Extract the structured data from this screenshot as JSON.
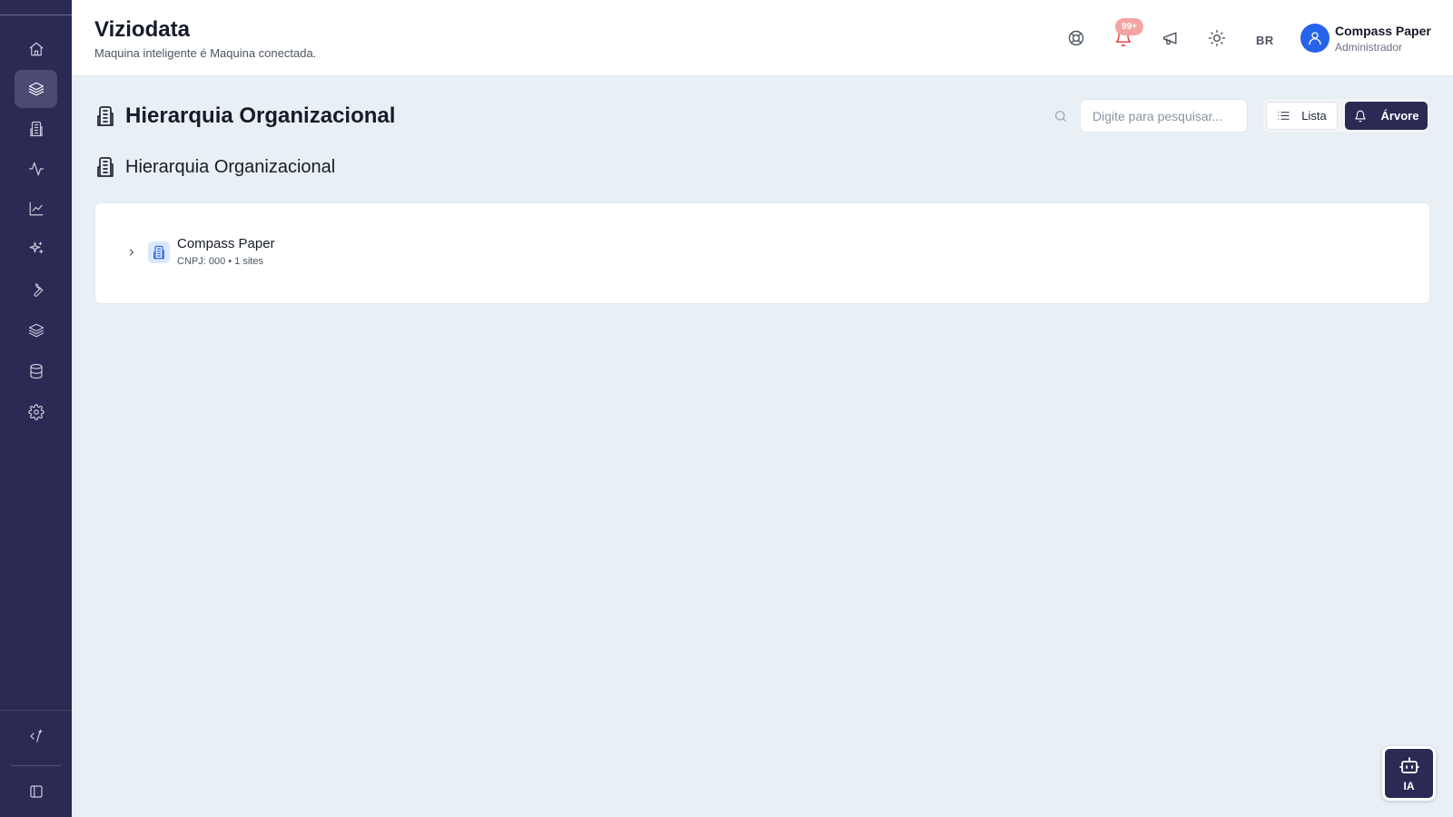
{
  "app": {
    "title": "Viziodata",
    "subtitle": "Maquina inteligente é Maquina conectada."
  },
  "sidebar": {
    "items": [
      {
        "icon": "home-icon"
      },
      {
        "icon": "layers-icon",
        "active": true
      },
      {
        "icon": "building-icon"
      },
      {
        "icon": "activity-icon"
      },
      {
        "icon": "line-chart-icon"
      },
      {
        "icon": "sparkles-icon"
      },
      {
        "icon": "wrench-icon"
      },
      {
        "icon": "layers-icon"
      },
      {
        "icon": "database-icon"
      },
      {
        "icon": "gear-icon"
      }
    ],
    "bottom_items": [
      {
        "icon": "code-spark-icon"
      },
      {
        "icon": "panel-toggle-icon"
      }
    ]
  },
  "header": {
    "notification_badge": "99+",
    "language": "BR",
    "user": {
      "name": "Compass Paper",
      "role": "Administrador"
    },
    "icons": [
      "lifebuoy-icon",
      "bell-icon",
      "megaphone-icon",
      "sun-icon"
    ]
  },
  "page": {
    "title": "Hierarquia Organizacional",
    "section_title": "Hierarquia Organizacional",
    "search": {
      "placeholder": "Digite para pesquisar...",
      "value": ""
    },
    "view_toggle": {
      "list_label": "Lista",
      "tree_label": "Árvore",
      "selected": "Árvore"
    }
  },
  "tree": {
    "nodes": [
      {
        "name": "Compass Paper",
        "meta": "CNPJ: 000 • 1 sites",
        "expanded": false
      }
    ]
  },
  "ai_button": {
    "label": "IA"
  },
  "colors": {
    "sidebar_bg": "#2b2a54",
    "accent": "#2563eb",
    "page_bg": "#e8eff5",
    "notification": "#e53935"
  }
}
